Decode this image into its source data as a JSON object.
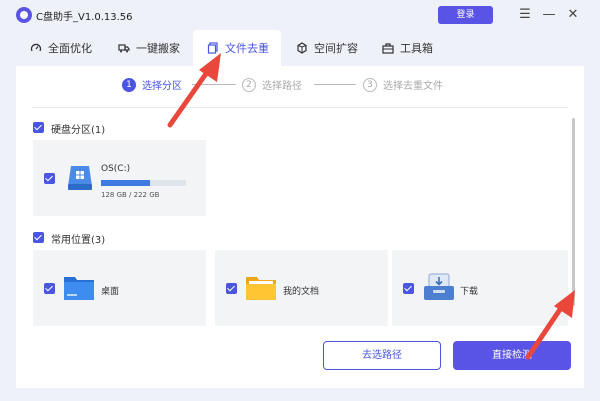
{
  "app": {
    "title": "C盘助手_V1.0.13.56",
    "login_label": "登录"
  },
  "window_controls": {
    "menu": "☰",
    "minimize": "—",
    "close": "✕"
  },
  "tabs": [
    {
      "label": "全面优化",
      "icon": "gauge-icon"
    },
    {
      "label": "一键搬家",
      "icon": "truck-icon"
    },
    {
      "label": "文件去重",
      "icon": "file-copy-icon",
      "active": true
    },
    {
      "label": "空间扩容",
      "icon": "expand-icon"
    },
    {
      "label": "工具箱",
      "icon": "toolbox-icon"
    }
  ],
  "steps": [
    {
      "num": "1",
      "label": "选择分区",
      "active": true
    },
    {
      "num": "2",
      "label": "选择路径"
    },
    {
      "num": "3",
      "label": "选择去重文件"
    }
  ],
  "partitions": {
    "title": "硬盘分区(1)",
    "items": [
      {
        "name": "OS(C:)",
        "size": "128 GB / 222 GB",
        "used_fraction": 0.58
      }
    ]
  },
  "locations": {
    "title": "常用位置(3)",
    "items": [
      {
        "name": "桌面",
        "icon": "desktop-folder-icon"
      },
      {
        "name": "我的文档",
        "icon": "documents-folder-icon"
      },
      {
        "name": "下载",
        "icon": "download-folder-icon"
      }
    ]
  },
  "buttons": {
    "select_path": "去选路径",
    "direct_scan": "直接检测"
  },
  "colors": {
    "accent": "#5a54e6",
    "annotation": "#e9473b"
  }
}
